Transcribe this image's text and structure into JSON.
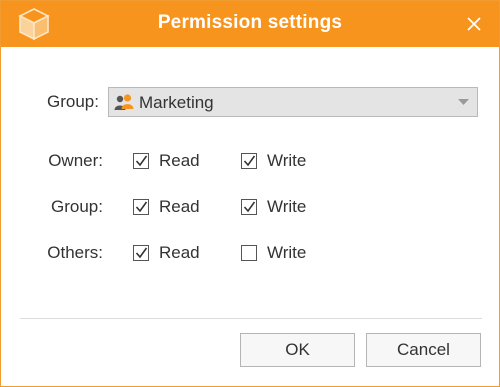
{
  "dialog": {
    "title": "Permission settings",
    "accent_color": "#f7941d",
    "icons": {
      "app": "box-icon",
      "close": "close-icon"
    }
  },
  "group": {
    "label": "Group:",
    "selected": "Marketing",
    "icon": "users-icon"
  },
  "permissions": {
    "read_label": "Read",
    "write_label": "Write",
    "rows": [
      {
        "label": "Owner:",
        "read": true,
        "write": true
      },
      {
        "label": "Group:",
        "read": true,
        "write": true
      },
      {
        "label": "Others:",
        "read": true,
        "write": false
      }
    ]
  },
  "buttons": {
    "ok": "OK",
    "cancel": "Cancel"
  }
}
